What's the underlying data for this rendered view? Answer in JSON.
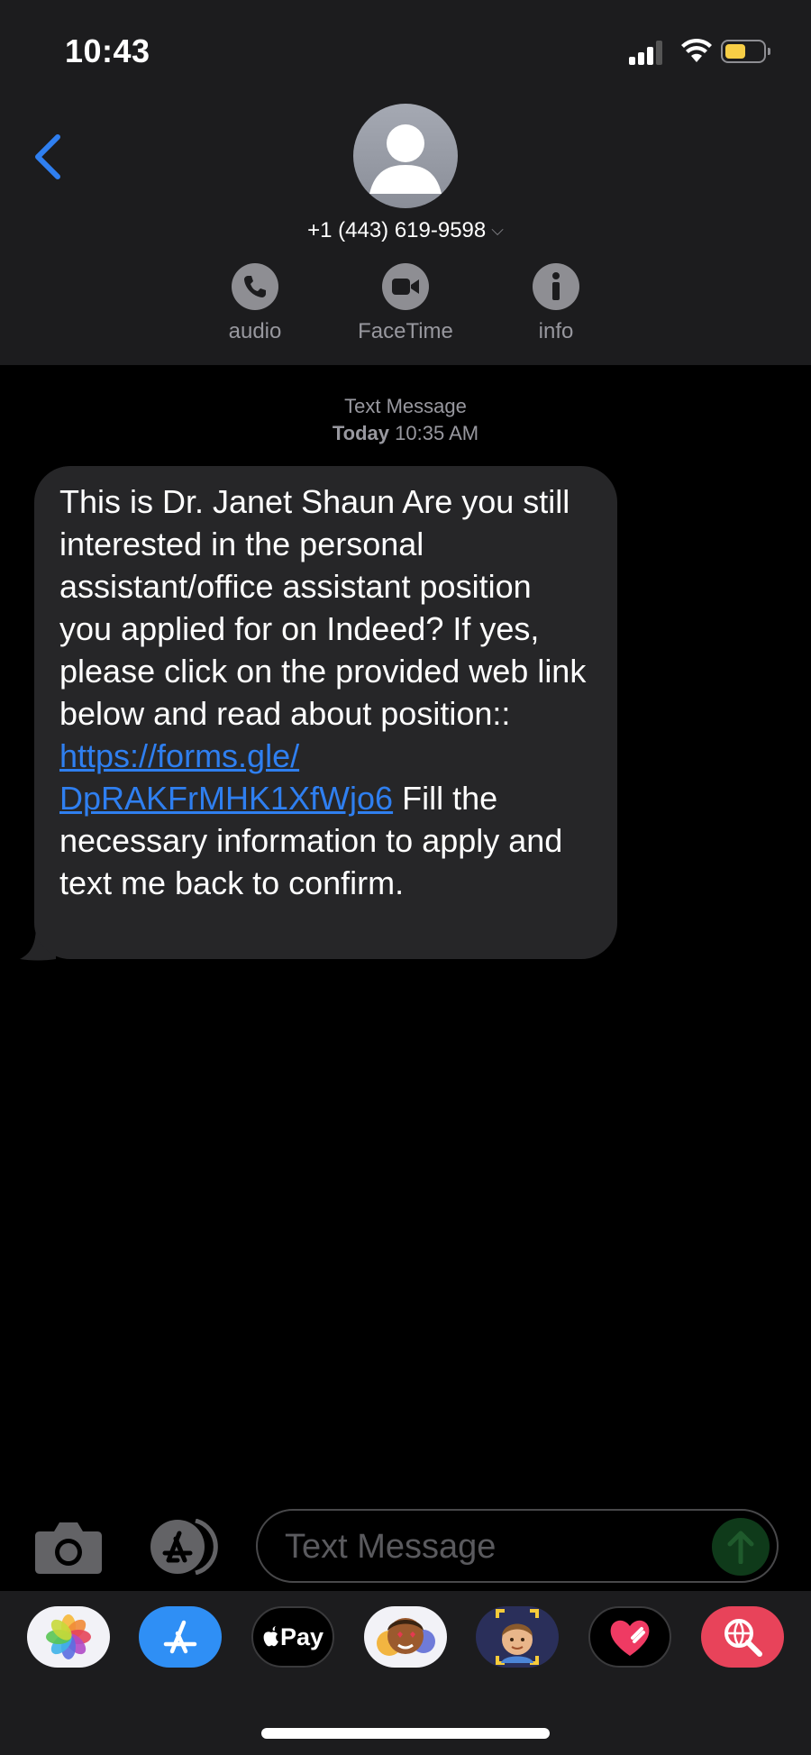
{
  "status_bar": {
    "time": "10:43"
  },
  "contact": {
    "number": "+1 (443) 619-9598"
  },
  "actions": [
    {
      "label": "audio",
      "icon": "phone-icon"
    },
    {
      "label": "FaceTime",
      "icon": "video-camera-icon"
    },
    {
      "label": "info",
      "icon": "info-icon"
    }
  ],
  "conversation": {
    "service": "Text Message",
    "timestamp_day": "Today",
    "timestamp_time": "10:35 AM",
    "message": {
      "text_before_link": "This is Dr. Janet Shaun Are you still interested in the personal assistant/office assistant position you applied for on Indeed? If yes, please click on the provided web link below and read about position::",
      "link_line1": "https://forms.gle/",
      "link_line2": "DpRAKFrMHK1XfWjo6",
      "text_after_link": "Fill the necessary information to apply and text me back to confirm."
    }
  },
  "composer": {
    "placeholder": "Text Message"
  },
  "app_drawer": [
    {
      "name": "photos-app-icon"
    },
    {
      "name": "app-store-icon"
    },
    {
      "name": "apple-pay-icon",
      "label": "Pay"
    },
    {
      "name": "memoji-stickers-icon"
    },
    {
      "name": "memoji-icon"
    },
    {
      "name": "digital-touch-icon"
    },
    {
      "name": "images-search-icon"
    }
  ],
  "colors": {
    "accent_blue": "#2f7ff0",
    "bubble": "#262628",
    "header": "#1c1c1e"
  }
}
